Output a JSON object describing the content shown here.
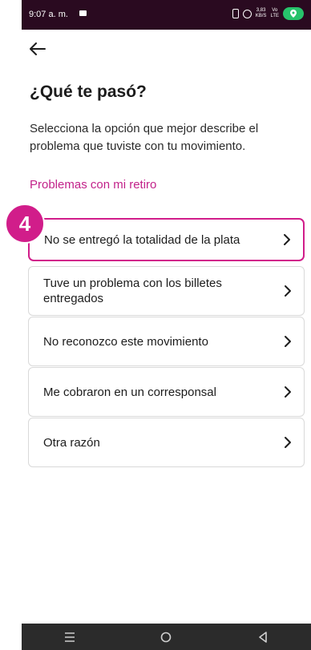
{
  "status_bar": {
    "time": "9:07 a. m.",
    "speed": "3,83\nKB/S",
    "network": "Vo\nLTE",
    "lte": "LTE",
    "location_icon": "location-pin-icon"
  },
  "header": {
    "back_icon": "arrow-left-icon"
  },
  "page": {
    "title": "¿Qué te pasó?",
    "description": "Selecciona la opción que mejor describe el problema que tuviste con tu movimiento.",
    "section_label": "Problemas con mi retiro"
  },
  "options": [
    {
      "label": "No se entregó la totalidad de la plata"
    },
    {
      "label": "Tuve un problema con los billetes entregados"
    },
    {
      "label": "No reconozco este movimiento"
    },
    {
      "label": "Me cobraron en un corresponsal"
    },
    {
      "label": "Otra razón"
    }
  ],
  "annotation": {
    "step_number": "4"
  },
  "colors": {
    "accent": "#c2228a",
    "highlight": "#d11d8a",
    "status_bar": "#2a0a20",
    "nav_bar": "#2b2b2b"
  },
  "nav": {
    "recents_icon": "menu-lines-icon",
    "home_icon": "circle-home-icon",
    "back_icon": "triangle-back-icon"
  }
}
